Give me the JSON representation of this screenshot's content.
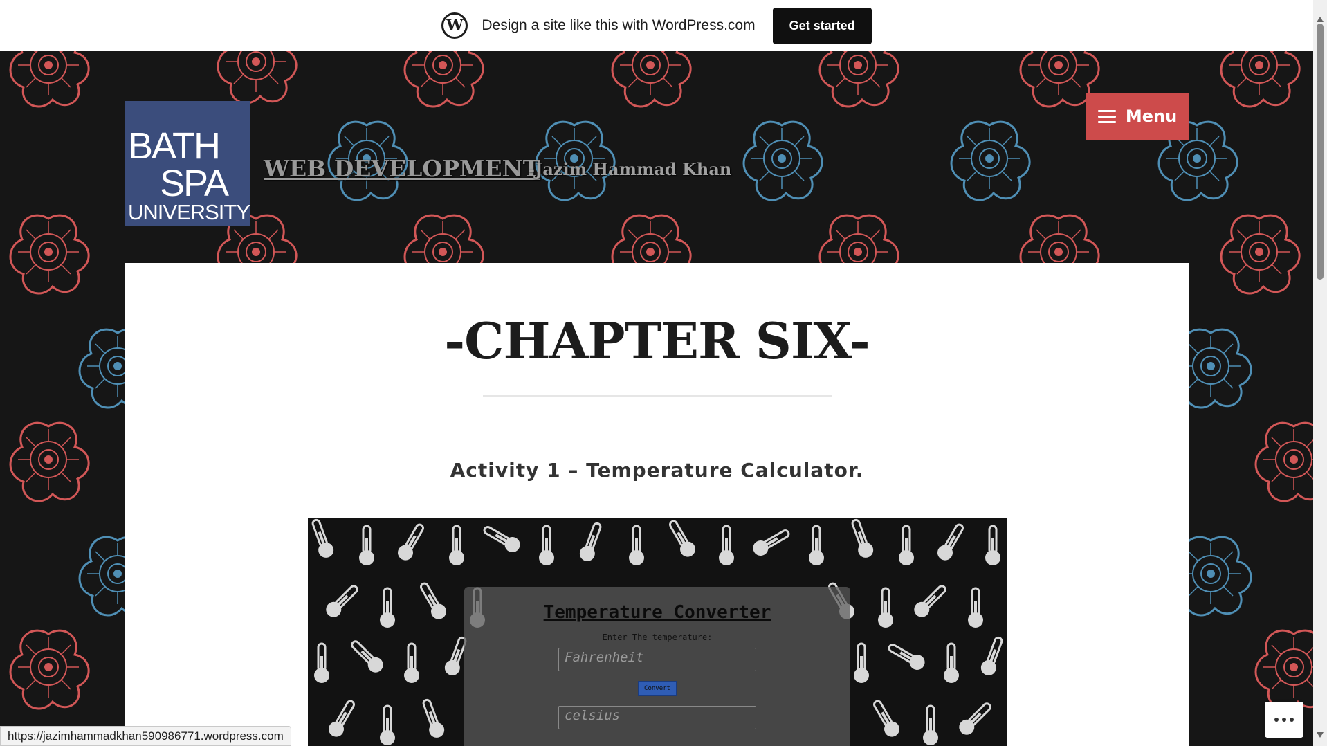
{
  "wp_bar": {
    "logo_letter": "W",
    "promo_text": "Design a site like this with WordPress.com",
    "cta_label": "Get started"
  },
  "header": {
    "logo_line1": "BATH",
    "logo_line2": "SPA",
    "logo_line3": "UNIVERSITY",
    "site_title": "WEB DEVELOPMENT",
    "tagline": "-Jazim Hammad Khan",
    "menu_label": "Menu"
  },
  "content": {
    "page_title": "-CHAPTER SIX-",
    "activity_heading": "Activity 1 – Temperature Calculator."
  },
  "converter": {
    "title": "Temperature Converter",
    "label": "Enter The temperature:",
    "fahrenheit_placeholder": "Fahrenheit",
    "convert_label": "Convert",
    "celsius_placeholder": "celsius"
  },
  "status_bar": {
    "url": "https://jazimhammadkhan590986771.wordpress.com"
  },
  "colors": {
    "accent_red": "#cd4b4b",
    "logo_blue": "#3b4d7c",
    "flower_red": "#d25757",
    "flower_blue": "#4f8fb5",
    "convert_blue": "#2f5db5"
  }
}
